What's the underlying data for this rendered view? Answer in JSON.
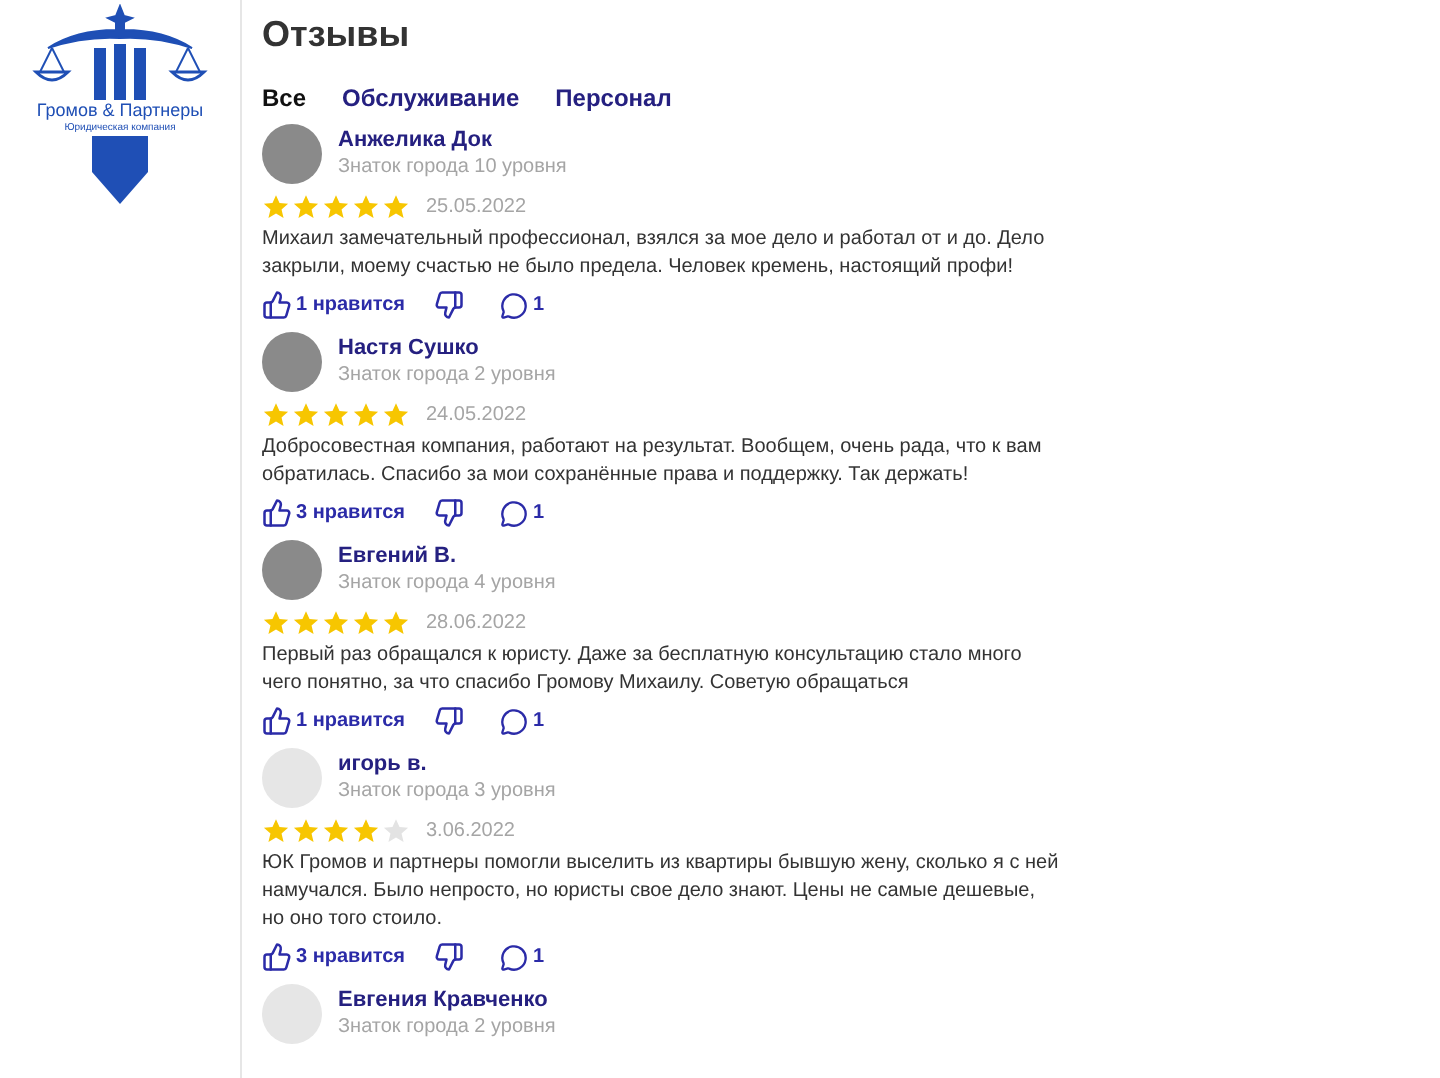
{
  "logo": {
    "name": "Громов & Партнеры",
    "tagline": "Юридическая компания"
  },
  "title": "Отзывы",
  "tabs": [
    {
      "label": "Все",
      "selected": true
    },
    {
      "label": "Обслуживание",
      "selected": false
    },
    {
      "label": "Персонал",
      "selected": false
    }
  ],
  "reviews": [
    {
      "author": "Анжелика Док",
      "level": "Знаток города 10 уровня",
      "has_photo": true,
      "stars": 5,
      "date": "25.05.2022",
      "text": "Михаил замечательный профессионал, взялся за мое дело и работал от и до. Дело закрыли, моему счастью не было предела. Человек кремень, настоящий профи!",
      "likes": "1 нравится",
      "comments": "1"
    },
    {
      "author": "Настя Сушко",
      "level": "Знаток города 2 уровня",
      "has_photo": true,
      "stars": 5,
      "date": "24.05.2022",
      "text": "Добросовестная компания, работают на результат. Вообщем, очень рада, что к вам обратилась. Спасибо за мои сохранённые права и поддержку. Так держать!",
      "likes": "3 нравится",
      "comments": "1"
    },
    {
      "author": "Евгений В.",
      "level": "Знаток города 4 уровня",
      "has_photo": true,
      "stars": 5,
      "date": "28.06.2022",
      "text": "Первый раз обращался к юристу. Даже за бесплатную консультацию стало много чего понятно, за что спасибо Громову Михаилу. Советую обращаться",
      "likes": "1 нравится",
      "comments": "1"
    },
    {
      "author": "игорь в.",
      "level": "Знаток города 3 уровня",
      "has_photo": false,
      "stars": 4,
      "date": "3.06.2022",
      "text": "ЮК Громов и партнеры помогли выселить из квартиры бывшую жену, сколько я с ней намучался. Было непросто, но юристы свое дело знают. Цены не самые дешевые, но оно того стоило.",
      "likes": "3 нравится",
      "comments": "1"
    },
    {
      "author": "Евгения Кравченко",
      "level": "Знаток города 2 уровня",
      "has_photo": false
    }
  ]
}
